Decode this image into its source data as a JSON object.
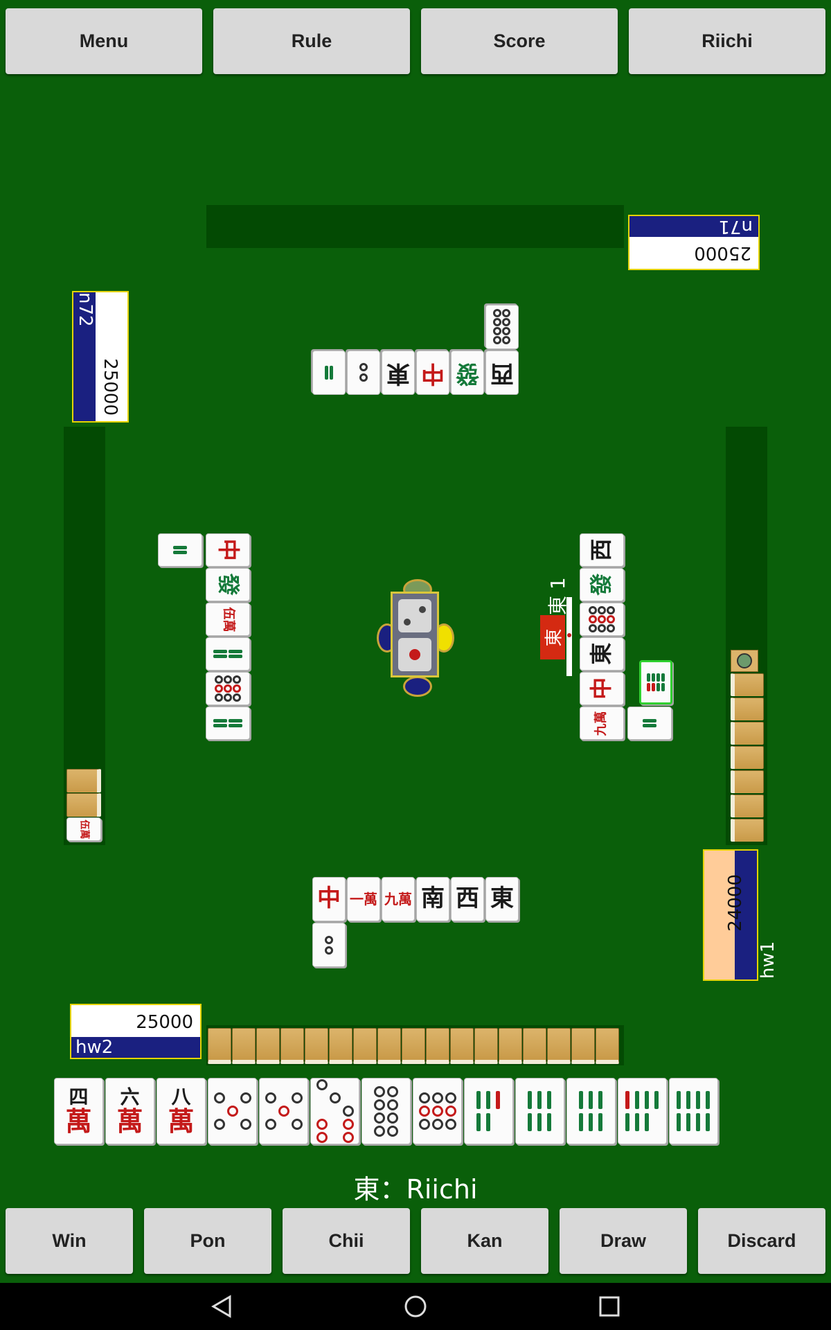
{
  "top_buttons": [
    "Menu",
    "Rule",
    "Score",
    "Riichi"
  ],
  "bottom_buttons": [
    "Win",
    "Pon",
    "Chii",
    "Kan",
    "Draw",
    "Discard"
  ],
  "players": {
    "top": {
      "name": "n71",
      "score": "25000"
    },
    "left": {
      "name": "n72",
      "score": "25000"
    },
    "right": {
      "name": "hw1",
      "score": "24000"
    },
    "bottom": {
      "name": "hw2",
      "score": "25000"
    }
  },
  "round": {
    "label": "東 1",
    "dealer_marker": "東"
  },
  "status_text": "東：Riichi",
  "discards": {
    "bottom_row1": [
      "中",
      "一萬",
      "九萬",
      "南",
      "西",
      "東"
    ],
    "bottom_row2": [
      "2-pin"
    ],
    "top_row1": [
      "2-sou",
      "2-pin",
      "東",
      "中",
      "發",
      "西"
    ],
    "top_row2": [
      "8-pin"
    ],
    "left_column": [
      "中",
      "發",
      "伍萬",
      "4-sou",
      "9-pin",
      "4-sou"
    ],
    "left_sideways": [
      "2-sou"
    ],
    "right_column": [
      "西",
      "發",
      "9-pin",
      "東",
      "中",
      "九萬"
    ],
    "right_sideways": [
      "2-sou",
      "8-sou"
    ]
  },
  "hand": [
    "四萬",
    "六萬",
    "八萬",
    "5-pin",
    "5-pin",
    "7-pin",
    "8-pin",
    "9-pin",
    "5-sou",
    "6-sou",
    "6-sou",
    "7-sou",
    "8-sou"
  ],
  "left_hand_tile": "伍萬",
  "colors": {
    "table": "#0a5f0a",
    "panel": "#034a03",
    "name_bar": "#1a2080",
    "highlight": "#ffcc99",
    "dealer": "#d42a12"
  },
  "nav": [
    "back-icon",
    "home-icon",
    "recents-icon"
  ]
}
